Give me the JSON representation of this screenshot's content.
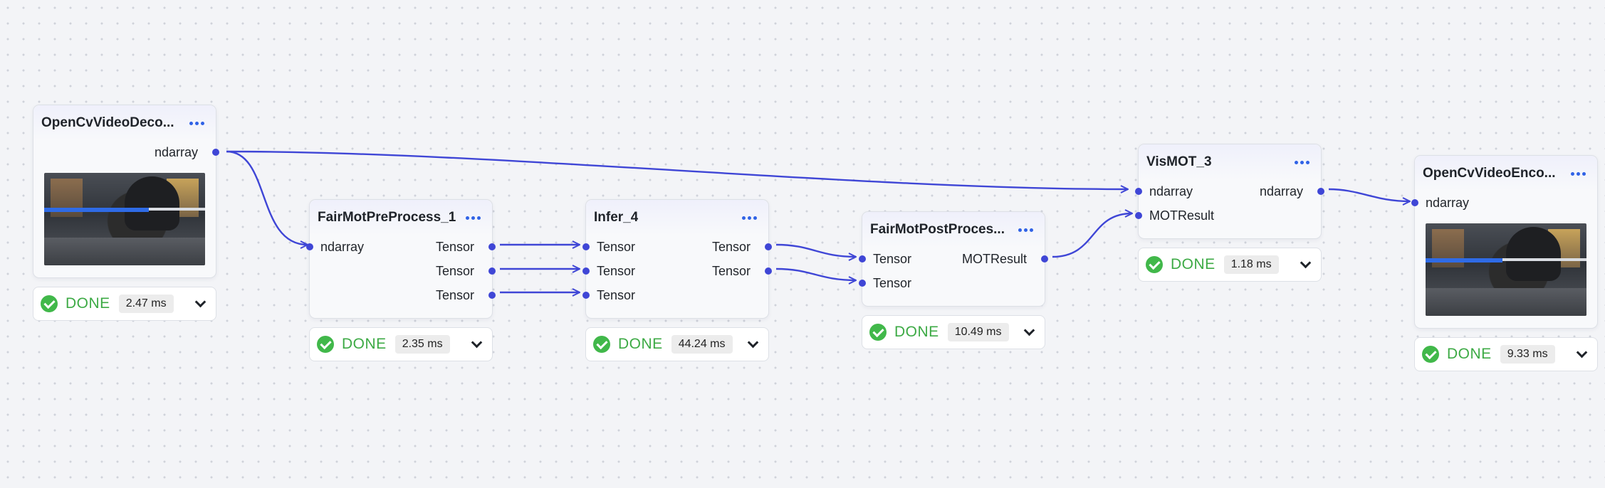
{
  "nodes": {
    "decoder": {
      "title": "OpenCvVideoDeco...",
      "outputs": [
        "ndarray"
      ],
      "status": "DONE",
      "time": "2.47 ms"
    },
    "preprocess": {
      "title": "FairMotPreProcess_1",
      "inputs": [
        "ndarray"
      ],
      "outputs": [
        "Tensor",
        "Tensor",
        "Tensor"
      ],
      "status": "DONE",
      "time": "2.35 ms"
    },
    "infer": {
      "title": "Infer_4",
      "inputs": [
        "Tensor",
        "Tensor",
        "Tensor"
      ],
      "outputs": [
        "Tensor",
        "Tensor"
      ],
      "status": "DONE",
      "time": "44.24 ms"
    },
    "postprocess": {
      "title": "FairMotPostProces...",
      "inputs": [
        "Tensor",
        "Tensor"
      ],
      "outputs": [
        "MOTResult"
      ],
      "status": "DONE",
      "time": "10.49 ms"
    },
    "vismot": {
      "title": "VisMOT_3",
      "inputs": [
        "ndarray",
        "MOTResult"
      ],
      "outputs": [
        "ndarray"
      ],
      "status": "DONE",
      "time": "1.18 ms"
    },
    "encoder": {
      "title": "OpenCvVideoEnco...",
      "inputs": [
        "ndarray"
      ],
      "status": "DONE",
      "time": "9.33 ms"
    }
  },
  "colors": {
    "edge": "#3f46d6",
    "done": "#3daa45",
    "menu": "#2f62e6"
  },
  "icons": {
    "menu": "more-horizontal-icon",
    "status": "check-circle-icon",
    "expand": "chevron-down-icon"
  }
}
